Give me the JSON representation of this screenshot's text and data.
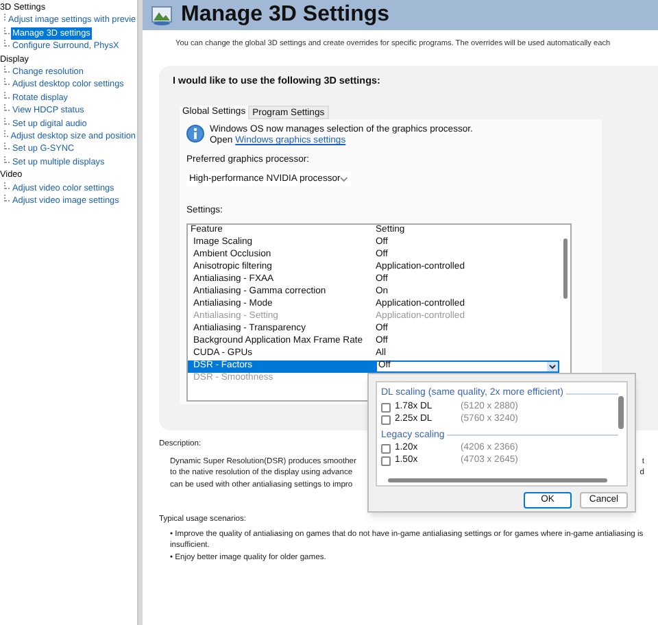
{
  "sidebar": {
    "groups": [
      {
        "label": "3D Settings",
        "children": [
          {
            "label": "Adjust image settings with previe",
            "selected": false
          },
          {
            "label": "Manage 3D settings",
            "selected": true
          },
          {
            "label": "Configure Surround, PhysX",
            "selected": false
          }
        ]
      },
      {
        "label": "Display",
        "children": [
          {
            "label": "Change resolution",
            "selected": false
          },
          {
            "label": "Adjust desktop color settings",
            "selected": false
          },
          {
            "label": "Rotate display",
            "selected": false
          },
          {
            "label": "View HDCP status",
            "selected": false
          },
          {
            "label": "Set up digital audio",
            "selected": false
          },
          {
            "label": "Adjust desktop size and position",
            "selected": false
          },
          {
            "label": "Set up G-SYNC",
            "selected": false
          },
          {
            "label": "Set up multiple displays",
            "selected": false
          }
        ]
      },
      {
        "label": "Video",
        "children": [
          {
            "label": "Adjust video color settings",
            "selected": false
          },
          {
            "label": "Adjust video image settings",
            "selected": false
          }
        ]
      }
    ]
  },
  "page": {
    "title": "Manage 3D Settings",
    "intro": "You can change the global 3D settings and create overrides for specific programs. The overrides will be used automatically each"
  },
  "panel": {
    "heading": "I would like to use the following 3D settings:",
    "tabs": [
      {
        "label": "Global Settings",
        "selected": true
      },
      {
        "label": "Program Settings",
        "selected": false
      }
    ],
    "notice": {
      "line1": "Windows OS now manages selection of the graphics processor.",
      "open": "Open",
      "link": "Windows graphics settings"
    },
    "processor_label": "Preferred graphics processor:",
    "processor_value": "High-performance NVIDIA processor",
    "settings_label": "Settings:",
    "columns": [
      "Feature",
      "Setting"
    ],
    "rows": [
      {
        "feature": "Image Scaling",
        "setting": "Off",
        "disabled": false,
        "selected": false
      },
      {
        "feature": "Ambient Occlusion",
        "setting": "Off",
        "disabled": false,
        "selected": false
      },
      {
        "feature": "Anisotropic filtering",
        "setting": "Application-controlled",
        "disabled": false,
        "selected": false
      },
      {
        "feature": "Antialiasing - FXAA",
        "setting": "Off",
        "disabled": false,
        "selected": false
      },
      {
        "feature": "Antialiasing - Gamma correction",
        "setting": "On",
        "disabled": false,
        "selected": false
      },
      {
        "feature": "Antialiasing - Mode",
        "setting": "Application-controlled",
        "disabled": false,
        "selected": false
      },
      {
        "feature": "Antialiasing - Setting",
        "setting": "Application-controlled",
        "disabled": true,
        "selected": false
      },
      {
        "feature": "Antialiasing - Transparency",
        "setting": "Off",
        "disabled": false,
        "selected": false
      },
      {
        "feature": "Background Application Max Frame Rate",
        "setting": "Off",
        "disabled": false,
        "selected": false
      },
      {
        "feature": "CUDA - GPUs",
        "setting": "All",
        "disabled": false,
        "selected": false
      },
      {
        "feature": "DSR - Factors",
        "setting": "Off",
        "disabled": false,
        "selected": true
      },
      {
        "feature": "DSR - Smoothness",
        "disabled": true,
        "selected": false
      }
    ]
  },
  "description": {
    "label": "Description:",
    "lines": [
      {
        "left": "Dynamic Super Resolution(DSR) produces smoother",
        "right": "t"
      },
      {
        "left": "to the native resolution of the display using advance",
        "right": "d"
      },
      {
        "left": "can be used with other antialiasing settings to impro"
      }
    ]
  },
  "usage": {
    "label": "Typical usage scenarios:",
    "bullets": [
      "• Improve the quality of antialiasing on games that do not have in-game antialiasing settings or for games where in-game antialiasing is insufficient.",
      "• Enjoy better image quality for older games."
    ]
  },
  "popup": {
    "groups": [
      {
        "title": "DL scaling (same quality, 2x more efficient)",
        "options": [
          {
            "label": "1.78x DL",
            "resolution": "(5120 x 2880)",
            "checked": false
          },
          {
            "label": "2.25x DL",
            "resolution": "(5760 x 3240)",
            "checked": false
          }
        ]
      },
      {
        "title": "Legacy scaling",
        "options": [
          {
            "label": "1.20x",
            "resolution": "(4206 x 2366)",
            "checked": false
          },
          {
            "label": "1.50x",
            "resolution": "(4703 x 2645)",
            "checked": false
          }
        ]
      }
    ],
    "buttons": [
      "OK",
      "Cancel"
    ]
  }
}
